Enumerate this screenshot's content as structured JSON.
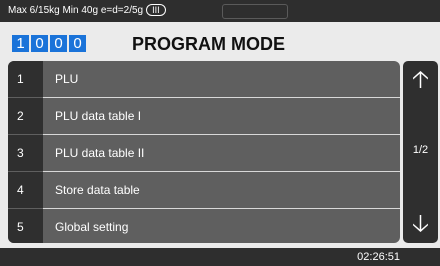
{
  "status_bar": {
    "specs": "Max 6/15kg Min 40g e=d=2/5g",
    "accuracy_class": "III"
  },
  "header": {
    "program_code": [
      "1",
      "0",
      "0",
      "0"
    ],
    "title": "PROGRAM MODE"
  },
  "menu": {
    "items": [
      {
        "number": "1",
        "label": "PLU"
      },
      {
        "number": "2",
        "label": "PLU data table I"
      },
      {
        "number": "3",
        "label": "PLU data table II"
      },
      {
        "number": "4",
        "label": "Store data table"
      },
      {
        "number": "5",
        "label": "Global setting"
      }
    ]
  },
  "pager": {
    "up_icon": "arrow-up-icon",
    "down_icon": "arrow-down-icon",
    "page_indicator": "1/2"
  },
  "footer": {
    "time": "02:26:51"
  },
  "colors": {
    "background": "#ebebeb",
    "bar": "#2e2e2e",
    "code_box": "#1a73d9",
    "menu_row": "#5f5f5f",
    "number_cell": "#2f2f2f"
  }
}
